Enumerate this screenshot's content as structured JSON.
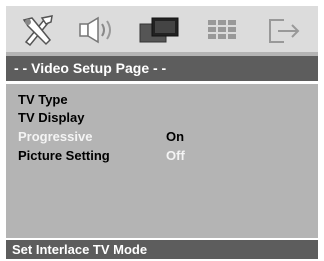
{
  "icons": [
    "tools-setup-icon",
    "speaker-audio-icon",
    "video-display-icon",
    "preferences-grid-icon",
    "exit-icon"
  ],
  "page_title": "- -  Video Setup Page  - -",
  "items": [
    {
      "label": "TV Type",
      "value": ""
    },
    {
      "label": "TV Display",
      "value": ""
    },
    {
      "label": "Progressive",
      "value": "On"
    },
    {
      "label": "Picture Setting",
      "value": "Off"
    }
  ],
  "status": "Set Interlace TV Mode",
  "colors": {
    "panel": "#b4b4b4",
    "bar": "#5d5d5d",
    "highlight_text": "#f4f4f4"
  }
}
